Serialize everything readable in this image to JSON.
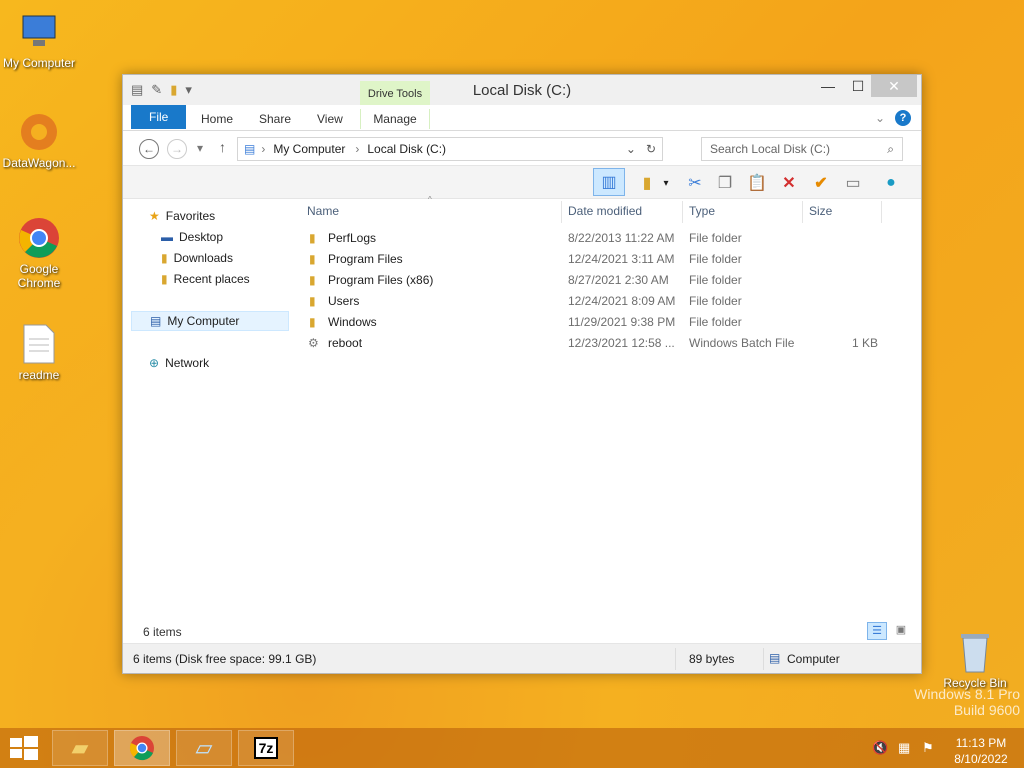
{
  "desktop": {
    "icons": [
      {
        "label": "My Computer"
      },
      {
        "label": "DataWagon..."
      },
      {
        "label": "Google Chrome"
      },
      {
        "label": "readme"
      },
      {
        "label": "Recycle Bin"
      }
    ],
    "watermark": {
      "line1": "Windows 8.1 Pro",
      "line2": "Build 9600"
    }
  },
  "window": {
    "title": "Local Disk (C:)",
    "close": "✕",
    "maximize": "☐",
    "minimize": "—"
  },
  "ribbon": {
    "file": "File",
    "home": "Home",
    "share": "Share",
    "view": "View",
    "context": "Drive Tools",
    "manage": "Manage"
  },
  "address": {
    "crumbs": [
      "My Computer",
      "Local Disk (C:)"
    ]
  },
  "search": {
    "placeholder": "Search Local Disk (C:)"
  },
  "nav": {
    "favorites": "Favorites",
    "desktop": "Desktop",
    "downloads": "Downloads",
    "recent": "Recent places",
    "computer": "My Computer",
    "network": "Network"
  },
  "columns": {
    "name": "Name",
    "date": "Date modified",
    "type": "Type",
    "size": "Size"
  },
  "files": [
    {
      "name": "PerfLogs",
      "date": "8/22/2013 11:22 AM",
      "type": "File folder",
      "size": ""
    },
    {
      "name": "Program Files",
      "date": "12/24/2021 3:11 AM",
      "type": "File folder",
      "size": ""
    },
    {
      "name": "Program Files (x86)",
      "date": "8/27/2021 2:30 AM",
      "type": "File folder",
      "size": ""
    },
    {
      "name": "Users",
      "date": "12/24/2021 8:09 AM",
      "type": "File folder",
      "size": ""
    },
    {
      "name": "Windows",
      "date": "11/29/2021 9:38 PM",
      "type": "File folder",
      "size": ""
    },
    {
      "name": "reboot",
      "date": "12/23/2021 12:58 ...",
      "type": "Windows Batch File",
      "size": "1 KB"
    }
  ],
  "status": {
    "items": "6 items",
    "details": "6 items (Disk free space: 99.1 GB)",
    "bytes": "89 bytes",
    "location": "Computer"
  },
  "tray": {
    "time": "11:13 PM",
    "date": "8/10/2022"
  }
}
